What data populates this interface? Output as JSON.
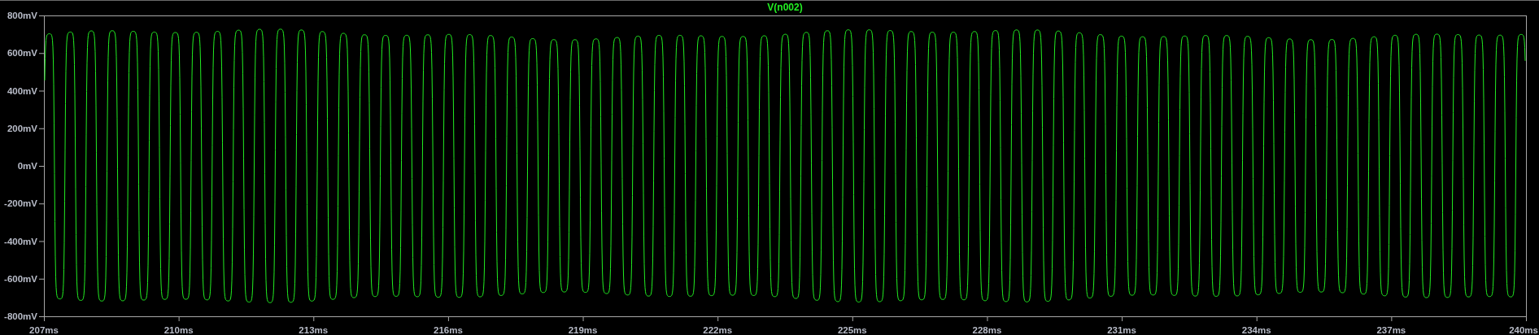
{
  "plot": {
    "trace_title": "V(n002)",
    "y_ticks": [
      "800mV",
      "600mV",
      "400mV",
      "200mV",
      "0mV",
      "-200mV",
      "-400mV",
      "-600mV",
      "-800mV"
    ],
    "x_ticks": [
      "207ms",
      "210ms",
      "213ms",
      "216ms",
      "219ms",
      "222ms",
      "225ms",
      "228ms",
      "231ms",
      "234ms",
      "237ms",
      "240ms"
    ]
  }
}
